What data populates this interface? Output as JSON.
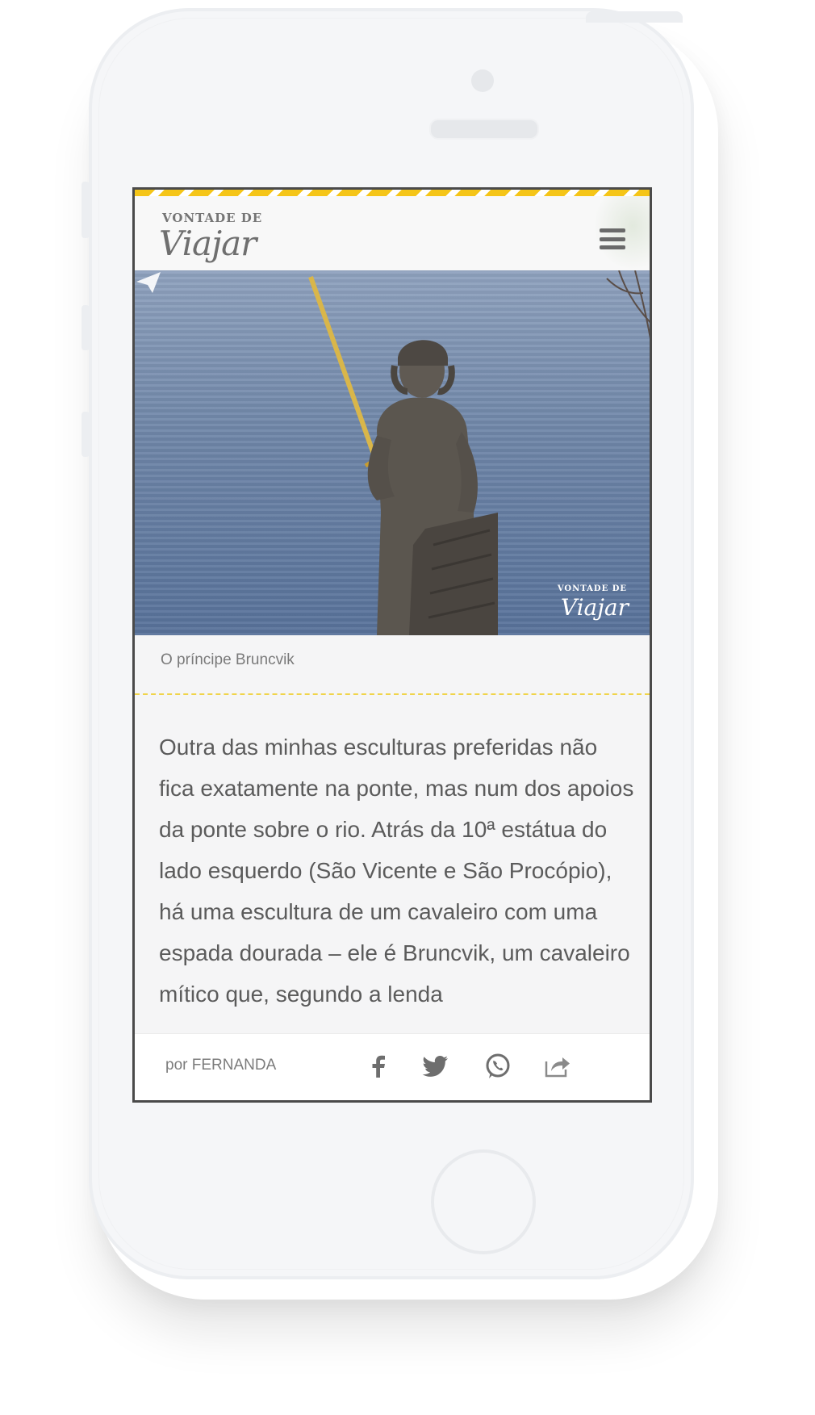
{
  "site": {
    "logo_small": "VONTADE DE",
    "logo_big": "Viajar"
  },
  "image": {
    "description_icon": "knight-statue-image",
    "watermark_small": "VONTADE DE",
    "watermark_big": "Viajar",
    "caption": "O príncipe Bruncvik"
  },
  "article": {
    "paragraph": "Outra das minhas esculturas preferidas não fica exatamente na ponte, mas num dos apoios da ponte sobre o rio. Atrás da 10ª estátua do lado esquerdo (São Vicente e São Procópio), há uma escultura de um cavaleiro com uma espada dourada – ele é Bruncvik, um cavaleiro mítico que, segundo a lenda"
  },
  "footer": {
    "author": "por FERNANDA",
    "share_icons": [
      "facebook-icon",
      "twitter-icon",
      "whatsapp-icon",
      "share-icon"
    ]
  },
  "colors": {
    "accent": "#f5c518",
    "text": "#5b5b5b",
    "icon": "#6a6a6a"
  }
}
